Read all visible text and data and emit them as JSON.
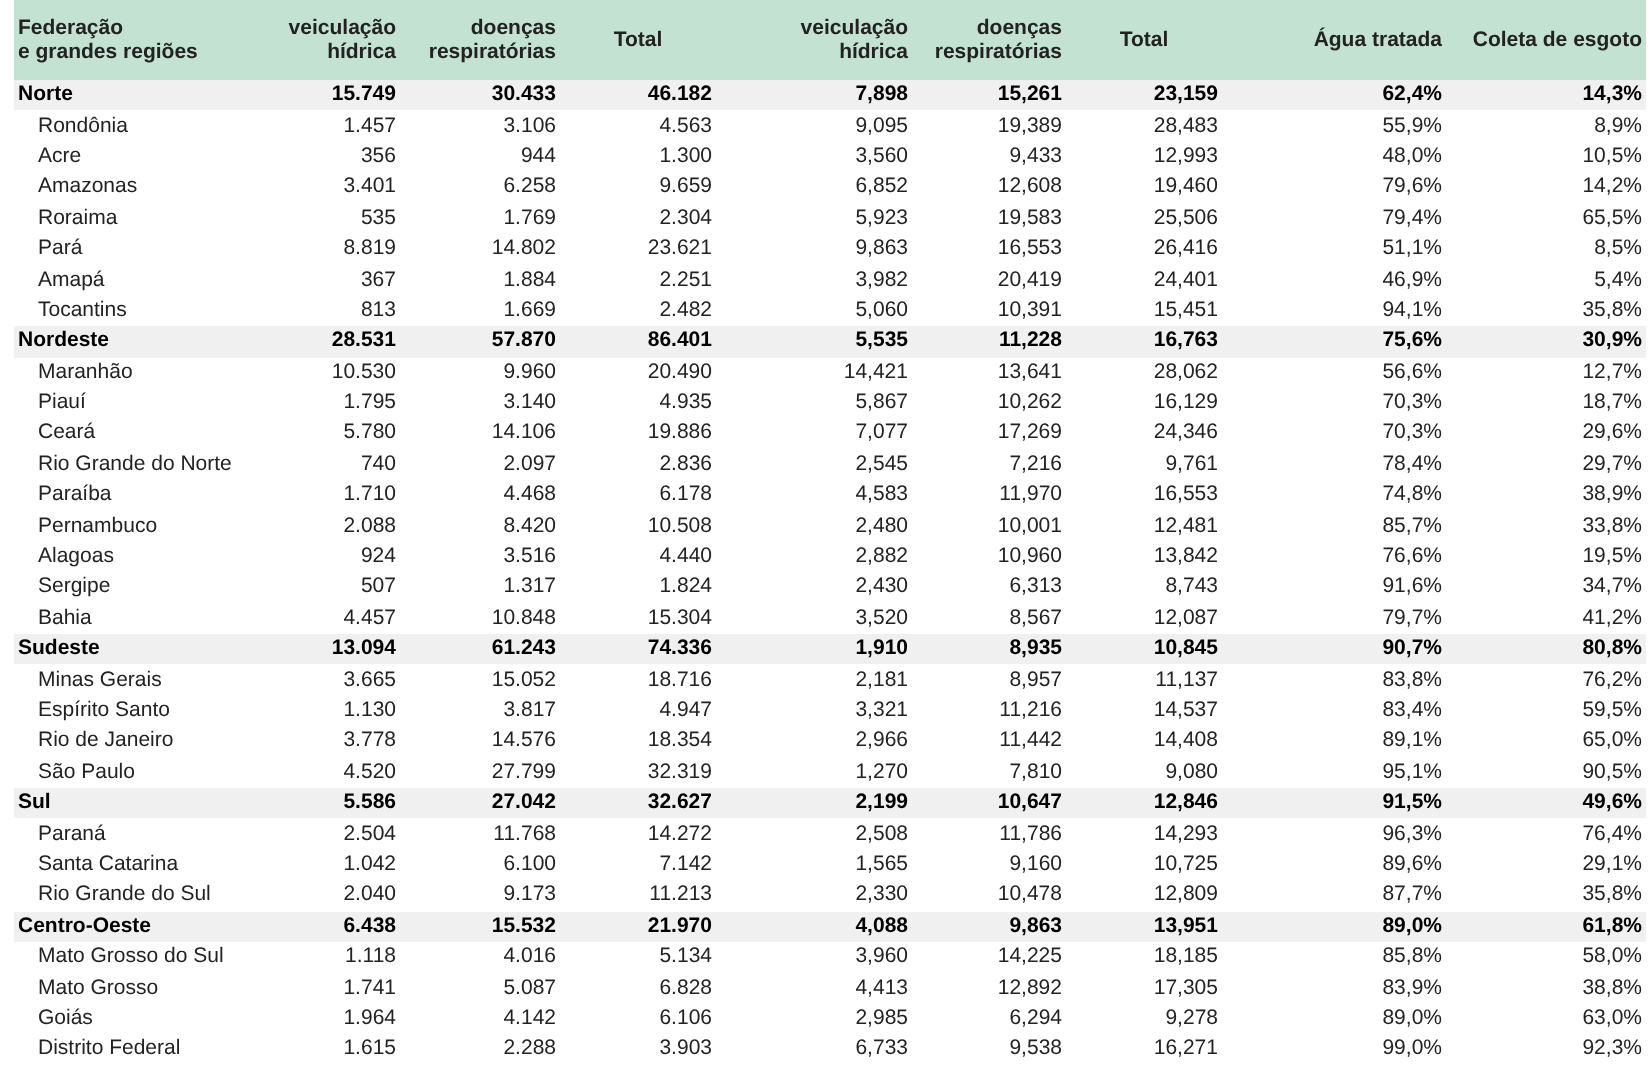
{
  "table": {
    "columns": [
      "Federação\ne grandes regiões",
      "veiculação\nhídrica",
      "doenças\nrespiratórias",
      "Total",
      "veiculação\nhídrica",
      "doenças\nrespiratórias",
      "Total",
      "Água tratada",
      "Coleta de esgoto"
    ],
    "rows": [
      {
        "kind": "region",
        "name": "Norte",
        "values": [
          "15.749",
          "30.433",
          "46.182",
          "7,898",
          "15,261",
          "23,159",
          "62,4%",
          "14,3%"
        ]
      },
      {
        "kind": "state",
        "name": "Rondônia",
        "values": [
          "1.457",
          "3.106",
          "4.563",
          "9,095",
          "19,389",
          "28,483",
          "55,9%",
          "8,9%"
        ]
      },
      {
        "kind": "state",
        "name": "Acre",
        "values": [
          "356",
          "944",
          "1.300",
          "3,560",
          "9,433",
          "12,993",
          "48,0%",
          "10,5%"
        ]
      },
      {
        "kind": "state",
        "name": "Amazonas",
        "values": [
          "3.401",
          "6.258",
          "9.659",
          "6,852",
          "12,608",
          "19,460",
          "79,6%",
          "14,2%"
        ]
      },
      {
        "kind": "state",
        "name": "Roraima",
        "values": [
          "535",
          "1.769",
          "2.304",
          "5,923",
          "19,583",
          "25,506",
          "79,4%",
          "65,5%"
        ]
      },
      {
        "kind": "state",
        "name": "Pará",
        "values": [
          "8.819",
          "14.802",
          "23.621",
          "9,863",
          "16,553",
          "26,416",
          "51,1%",
          "8,5%"
        ]
      },
      {
        "kind": "state",
        "name": "Amapá",
        "values": [
          "367",
          "1.884",
          "2.251",
          "3,982",
          "20,419",
          "24,401",
          "46,9%",
          "5,4%"
        ]
      },
      {
        "kind": "state",
        "name": "Tocantins",
        "values": [
          "813",
          "1.669",
          "2.482",
          "5,060",
          "10,391",
          "15,451",
          "94,1%",
          "35,8%"
        ]
      },
      {
        "kind": "region",
        "name": "Nordeste",
        "values": [
          "28.531",
          "57.870",
          "86.401",
          "5,535",
          "11,228",
          "16,763",
          "75,6%",
          "30,9%"
        ]
      },
      {
        "kind": "state",
        "name": "Maranhão",
        "values": [
          "10.530",
          "9.960",
          "20.490",
          "14,421",
          "13,641",
          "28,062",
          "56,6%",
          "12,7%"
        ]
      },
      {
        "kind": "state",
        "name": "Piauí",
        "values": [
          "1.795",
          "3.140",
          "4.935",
          "5,867",
          "10,262",
          "16,129",
          "70,3%",
          "18,7%"
        ]
      },
      {
        "kind": "state",
        "name": "Ceará",
        "values": [
          "5.780",
          "14.106",
          "19.886",
          "7,077",
          "17,269",
          "24,346",
          "70,3%",
          "29,6%"
        ]
      },
      {
        "kind": "state",
        "name": "Rio Grande do Norte",
        "values": [
          "740",
          "2.097",
          "2.836",
          "2,545",
          "7,216",
          "9,761",
          "78,4%",
          "29,7%"
        ]
      },
      {
        "kind": "state",
        "name": "Paraíba",
        "values": [
          "1.710",
          "4.468",
          "6.178",
          "4,583",
          "11,970",
          "16,553",
          "74,8%",
          "38,9%"
        ]
      },
      {
        "kind": "state",
        "name": "Pernambuco",
        "values": [
          "2.088",
          "8.420",
          "10.508",
          "2,480",
          "10,001",
          "12,481",
          "85,7%",
          "33,8%"
        ]
      },
      {
        "kind": "state",
        "name": "Alagoas",
        "values": [
          "924",
          "3.516",
          "4.440",
          "2,882",
          "10,960",
          "13,842",
          "76,6%",
          "19,5%"
        ]
      },
      {
        "kind": "state",
        "name": "Sergipe",
        "values": [
          "507",
          "1.317",
          "1.824",
          "2,430",
          "6,313",
          "8,743",
          "91,6%",
          "34,7%"
        ]
      },
      {
        "kind": "state",
        "name": "Bahia",
        "values": [
          "4.457",
          "10.848",
          "15.304",
          "3,520",
          "8,567",
          "12,087",
          "79,7%",
          "41,2%"
        ]
      },
      {
        "kind": "region",
        "name": "Sudeste",
        "values": [
          "13.094",
          "61.243",
          "74.336",
          "1,910",
          "8,935",
          "10,845",
          "90,7%",
          "80,8%"
        ]
      },
      {
        "kind": "state",
        "name": "Minas Gerais",
        "values": [
          "3.665",
          "15.052",
          "18.716",
          "2,181",
          "8,957",
          "11,137",
          "83,8%",
          "76,2%"
        ]
      },
      {
        "kind": "state",
        "name": "Espírito Santo",
        "values": [
          "1.130",
          "3.817",
          "4.947",
          "3,321",
          "11,216",
          "14,537",
          "83,4%",
          "59,5%"
        ]
      },
      {
        "kind": "state",
        "name": "Rio de Janeiro",
        "values": [
          "3.778",
          "14.576",
          "18.354",
          "2,966",
          "11,442",
          "14,408",
          "89,1%",
          "65,0%"
        ]
      },
      {
        "kind": "state",
        "name": "São Paulo",
        "values": [
          "4.520",
          "27.799",
          "32.319",
          "1,270",
          "7,810",
          "9,080",
          "95,1%",
          "90,5%"
        ]
      },
      {
        "kind": "region",
        "name": "Sul",
        "values": [
          "5.586",
          "27.042",
          "32.627",
          "2,199",
          "10,647",
          "12,846",
          "91,5%",
          "49,6%"
        ]
      },
      {
        "kind": "state",
        "name": "Paraná",
        "values": [
          "2.504",
          "11.768",
          "14.272",
          "2,508",
          "11,786",
          "14,293",
          "96,3%",
          "76,4%"
        ]
      },
      {
        "kind": "state",
        "name": "Santa Catarina",
        "values": [
          "1.042",
          "6.100",
          "7.142",
          "1,565",
          "9,160",
          "10,725",
          "89,6%",
          "29,1%"
        ]
      },
      {
        "kind": "state",
        "name": "Rio Grande do Sul",
        "values": [
          "2.040",
          "9.173",
          "11.213",
          "2,330",
          "10,478",
          "12,809",
          "87,7%",
          "35,8%"
        ]
      },
      {
        "kind": "region",
        "name": "Centro-Oeste",
        "values": [
          "6.438",
          "15.532",
          "21.970",
          "4,088",
          "9,863",
          "13,951",
          "89,0%",
          "61,8%"
        ]
      },
      {
        "kind": "state",
        "name": "Mato Grosso do Sul",
        "values": [
          "1.118",
          "4.016",
          "5.134",
          "3,960",
          "14,225",
          "18,185",
          "85,8%",
          "58,0%"
        ]
      },
      {
        "kind": "state",
        "name": "Mato Grosso",
        "values": [
          "1.741",
          "5.087",
          "6.828",
          "4,413",
          "12,892",
          "17,305",
          "83,9%",
          "38,8%"
        ]
      },
      {
        "kind": "state",
        "name": "Goiás",
        "values": [
          "1.964",
          "4.142",
          "6.106",
          "2,985",
          "6,294",
          "9,278",
          "89,0%",
          "63,0%"
        ]
      },
      {
        "kind": "state",
        "name": "Distrito Federal",
        "values": [
          "1.615",
          "2.288",
          "3.903",
          "6,733",
          "9,538",
          "16,271",
          "99,0%",
          "92,3%"
        ]
      }
    ]
  }
}
